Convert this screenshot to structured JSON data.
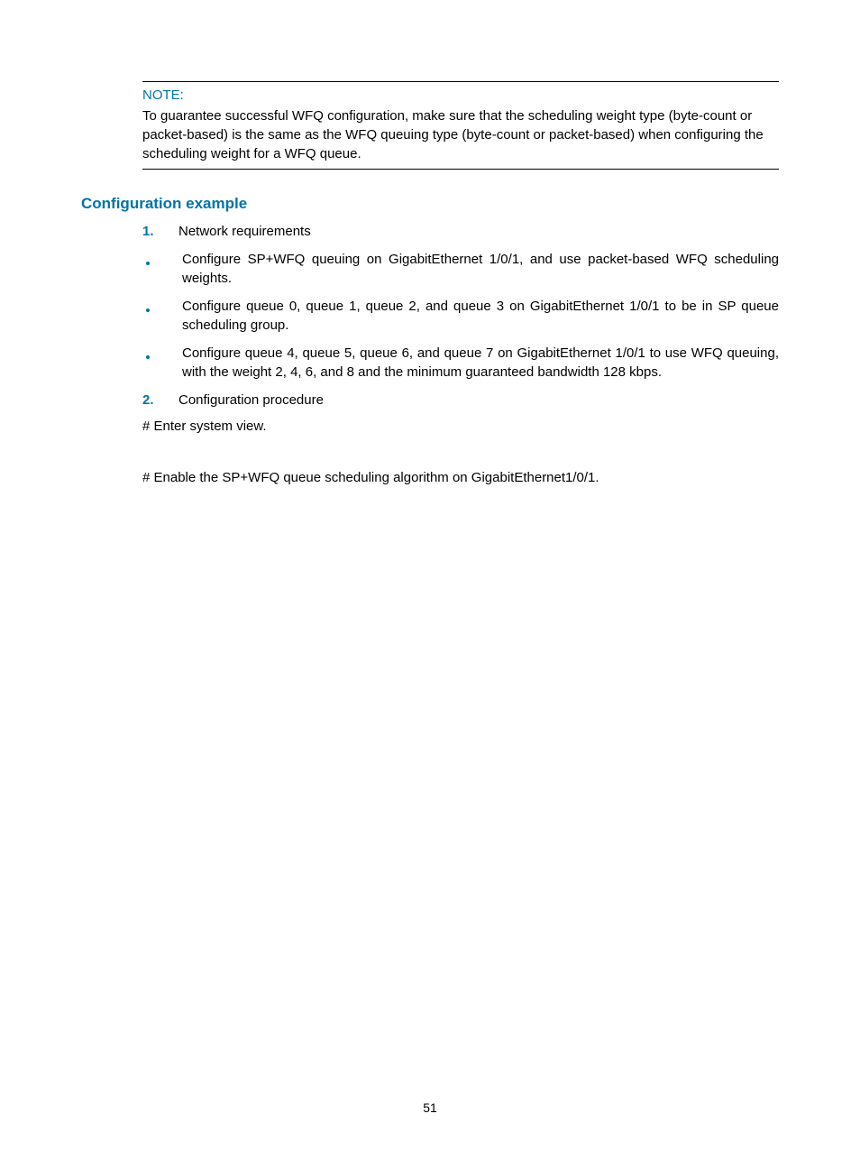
{
  "note": {
    "label": "NOTE:",
    "text": "To guarantee successful WFQ configuration, make sure that the scheduling weight type (byte-count or packet-based) is the same as the WFQ queuing type (byte-count or packet-based) when configuring the scheduling weight for a WFQ queue."
  },
  "section_heading": "Configuration example",
  "items": [
    {
      "marker": "1.",
      "type": "num",
      "text": "Network requirements"
    },
    {
      "marker": "",
      "type": "bullet",
      "text": "Configure SP+WFQ queuing on GigabitEthernet 1/0/1, and use packet-based WFQ scheduling weights."
    },
    {
      "marker": "",
      "type": "bullet",
      "text": "Configure queue 0, queue 1, queue 2, and queue 3 on GigabitEthernet 1/0/1 to be in SP queue scheduling group."
    },
    {
      "marker": "",
      "type": "bullet",
      "text": "Configure queue 4, queue 5, queue 6, and queue 7 on GigabitEthernet 1/0/1 to use WFQ queuing, with the weight 2, 4, 6, and 8 and the minimum guaranteed bandwidth 128 kbps."
    },
    {
      "marker": "2.",
      "type": "num",
      "text": "Configuration procedure"
    }
  ],
  "paras": [
    "# Enter system view.",
    "# Enable the SP+WFQ queue scheduling algorithm on GigabitEthernet1/0/1."
  ],
  "page_number": "51"
}
